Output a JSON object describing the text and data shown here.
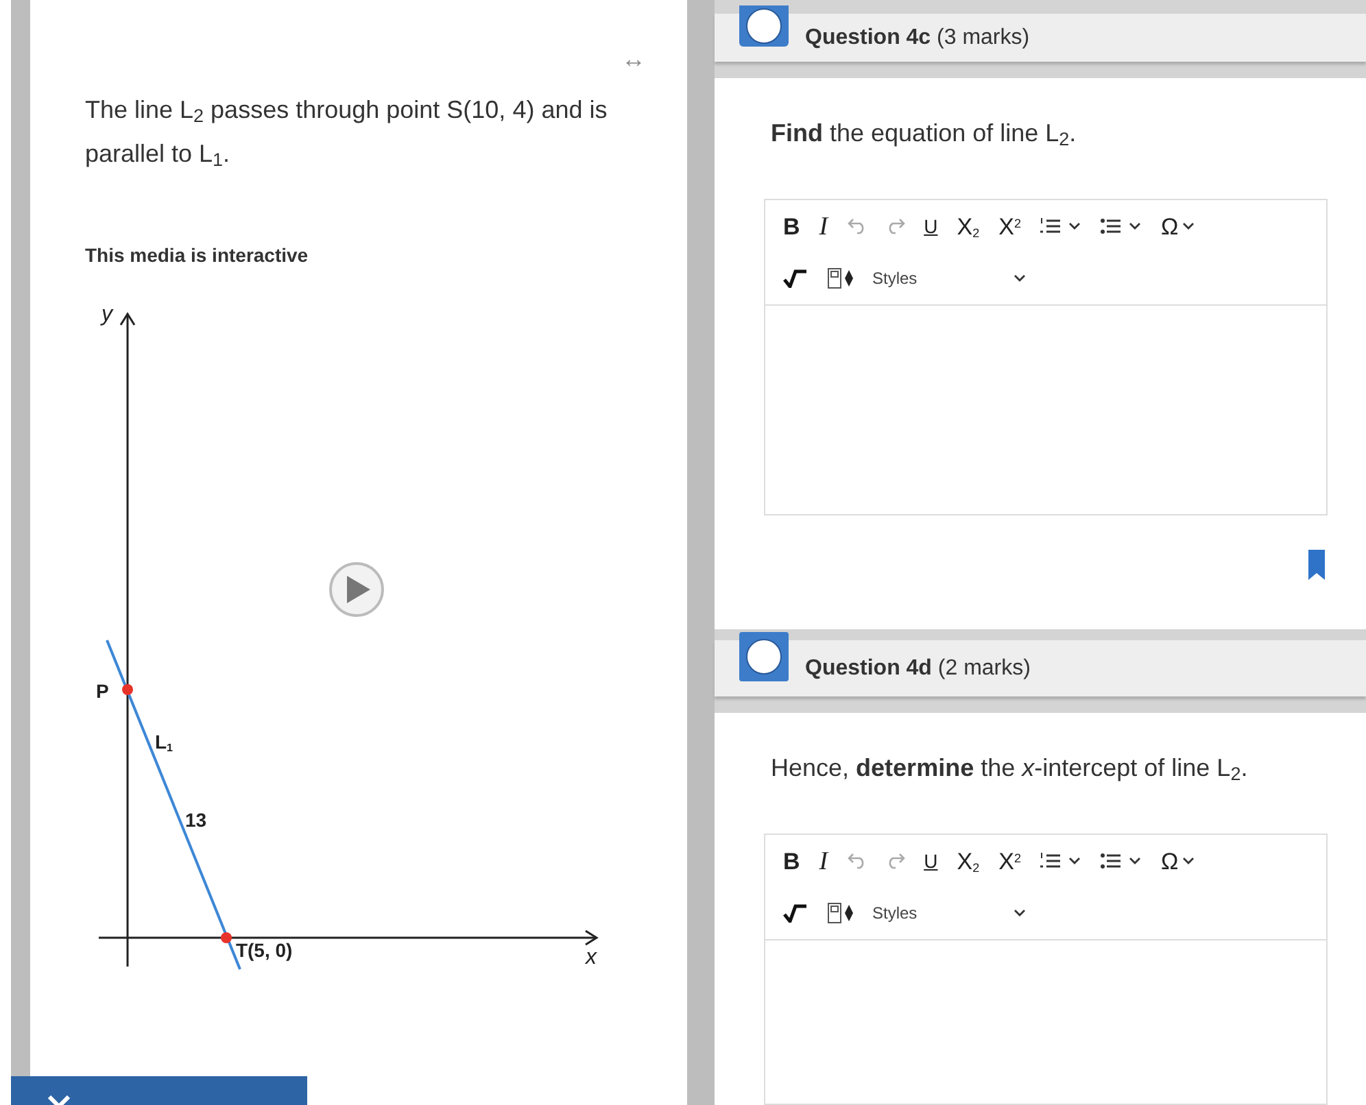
{
  "stimulus": {
    "resize_glyph": "↔",
    "text": "The line L$_{2}$ passes through point S(10, 4) and is parallel to L$_{1}$.",
    "media_note": "This media is interactive",
    "diagram": {
      "labels": [
        {
          "kind": "axis",
          "text": "y"
        },
        {
          "kind": "axis",
          "text": "x"
        },
        {
          "kind": "point",
          "text": "P"
        },
        {
          "kind": "line",
          "text": "L$_{1}$"
        },
        {
          "kind": "length",
          "text": "13"
        },
        {
          "kind": "point",
          "text": "T(5, 0)"
        }
      ]
    }
  },
  "questions": [
    {
      "title": "Question 4c",
      "marks": "(3 marks)",
      "prompt": "**Find** the equation of line L$_{2}$.",
      "flagged": true,
      "editor": {
        "styles_dropdown": "Styles",
        "toolbar": [
          {
            "kind": "bold",
            "label": "B",
            "disabled": false
          },
          {
            "kind": "italic",
            "label": "I",
            "disabled": false
          },
          {
            "kind": "undo",
            "disabled": true
          },
          {
            "kind": "redo",
            "disabled": true
          },
          {
            "kind": "underline",
            "label": "U",
            "disabled": false
          },
          {
            "kind": "subscript",
            "label": "X$_{2}$",
            "disabled": false
          },
          {
            "kind": "superscript",
            "label": "X$^{2}$",
            "disabled": false
          },
          {
            "kind": "numbered-list",
            "disabled": false
          },
          {
            "kind": "bulleted-list",
            "disabled": false
          },
          {
            "kind": "special-char",
            "label": "Ω",
            "disabled": false
          }
        ]
      }
    },
    {
      "title": "Question 4d",
      "marks": "(2 marks)",
      "prompt": "Hence, **determine** the *x*-intercept of line L$_{2}$.",
      "flagged": false,
      "editor": {
        "styles_dropdown": "Styles",
        "toolbar": [
          {
            "kind": "bold",
            "label": "B",
            "disabled": false
          },
          {
            "kind": "italic",
            "label": "I",
            "disabled": false
          },
          {
            "kind": "undo",
            "disabled": true
          },
          {
            "kind": "redo",
            "disabled": true
          },
          {
            "kind": "underline",
            "label": "U",
            "disabled": false
          },
          {
            "kind": "subscript",
            "label": "X$_{2}$",
            "disabled": false
          },
          {
            "kind": "superscript",
            "label": "X$^{2}$",
            "disabled": false
          },
          {
            "kind": "numbered-list",
            "disabled": false
          },
          {
            "kind": "bulleted-list",
            "disabled": false
          },
          {
            "kind": "special-char",
            "label": "Ω",
            "disabled": false
          }
        ]
      }
    }
  ]
}
